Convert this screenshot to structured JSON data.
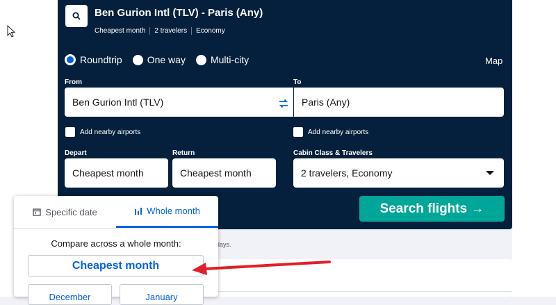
{
  "summary": {
    "route": "Ben Gurion Intl (TLV) - Paris (Any)",
    "meta": [
      "Cheapest month",
      "2 travelers",
      "Economy"
    ]
  },
  "trip_type": {
    "options": [
      "Roundtrip",
      "One way",
      "Multi-city"
    ],
    "selected": "Roundtrip",
    "map_label": "Map"
  },
  "from": {
    "label": "From",
    "value": "Ben Gurion Intl (TLV)",
    "nearby_label": "Add nearby airports"
  },
  "to": {
    "label": "To",
    "value": "Paris (Any)",
    "nearby_label": "Add nearby airports"
  },
  "depart": {
    "label": "Depart",
    "value": "Cheapest month"
  },
  "return": {
    "label": "Return",
    "value": "Cheapest month"
  },
  "cabin": {
    "label": "Cabin Class & Travelers",
    "value": "2 travelers, Economy"
  },
  "search_button": "Search flights →",
  "below_text": "days.",
  "popover": {
    "tab_specific": "Specific date",
    "tab_whole": "Whole month",
    "compare_text": "Compare across a whole month:",
    "cheapest_button": "Cheapest month",
    "months": [
      "December",
      "January"
    ]
  },
  "colors": {
    "panel": "#05203c",
    "accent": "#0062e3",
    "search_button": "#00a698",
    "annotation_arrow": "#e0202a"
  }
}
